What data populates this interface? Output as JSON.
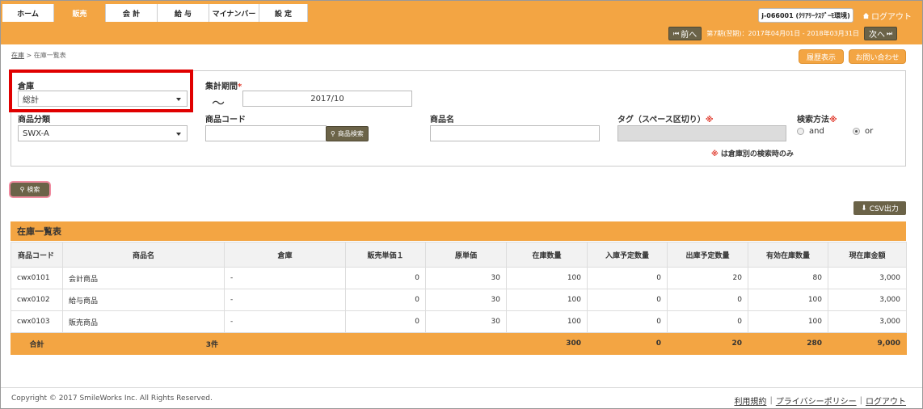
{
  "nav": {
    "tabs": [
      {
        "label": "ホーム"
      },
      {
        "label": "販売"
      },
      {
        "label": "会 計"
      },
      {
        "label": "給 与"
      },
      {
        "label": "マイナンバー"
      },
      {
        "label": "設 定"
      }
    ],
    "environment": "j-066001 (ｸﾘｱﾘｰｸｽﾃﾞｰﾓ環境)",
    "logout": "ログアウト",
    "prev": "前へ",
    "next": "次へ",
    "period": "第7期(翌期)：2017年04月01日 - 2018年03月31日"
  },
  "breadcrumb": {
    "root": "在庫",
    "sep": ">",
    "current": "在庫一覧表"
  },
  "actions": {
    "history": "履歴表示",
    "contact": "お問い合わせ"
  },
  "search": {
    "warehouse_label": "倉庫",
    "warehouse_value": "総計",
    "period_label": "集計期間",
    "period_required": "*",
    "period_tilde": "～",
    "period_value": "2017/10",
    "category_label": "商品分類",
    "category_value": "SWX-A",
    "code_label": "商品コード",
    "code_search_button": "商品検索",
    "name_label": "商品名",
    "tag_label": "タグ（スペース区切り）",
    "tag_mark": "※",
    "method_label": "検索方法",
    "method_mark": "※",
    "method_and": "and",
    "method_or": "or",
    "note_mark": "※",
    "note": "は倉庫別の検索時のみ",
    "search_button": "検索"
  },
  "csv_button": "CSV出力",
  "table": {
    "title": "在庫一覧表",
    "columns": [
      "商品コード",
      "商品名",
      "倉庫",
      "販売単価１",
      "原単価",
      "在庫数量",
      "入庫予定数量",
      "出庫予定数量",
      "有効在庫数量",
      "現在庫金額"
    ],
    "rows": [
      {
        "code": "cwx0101",
        "name": "会計商品",
        "warehouse": "-",
        "price": "0",
        "cost": "30",
        "stock": "100",
        "incoming": "0",
        "outgoing": "20",
        "available": "80",
        "amount": "3,000"
      },
      {
        "code": "cwx0102",
        "name": "給与商品",
        "warehouse": "-",
        "price": "0",
        "cost": "30",
        "stock": "100",
        "incoming": "0",
        "outgoing": "0",
        "available": "100",
        "amount": "3,000"
      },
      {
        "code": "cwx0103",
        "name": "販売商品",
        "warehouse": "-",
        "price": "0",
        "cost": "30",
        "stock": "100",
        "incoming": "0",
        "outgoing": "0",
        "available": "100",
        "amount": "3,000"
      }
    ],
    "total": {
      "label": "合計",
      "count": "3件",
      "stock": "300",
      "incoming": "0",
      "outgoing": "20",
      "available": "280",
      "amount": "9,000"
    }
  },
  "footer": {
    "copyright": "Copyright © 2017 SmileWorks Inc. All Rights Reserved.",
    "terms": "利用規約",
    "privacy": "プライバシーポリシー",
    "logout": "ログアウト",
    "sep": "|"
  },
  "colors": {
    "accent": "#f3a543",
    "button_dark": "#6b6348",
    "highlight": "#e00000"
  }
}
